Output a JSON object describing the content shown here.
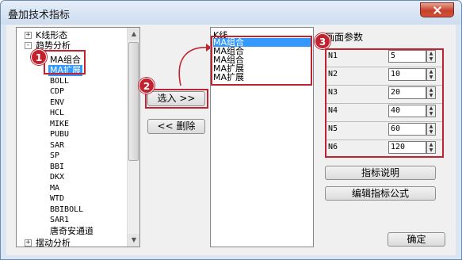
{
  "window": {
    "title": "叠加技术指标"
  },
  "tree": {
    "nodes": [
      {
        "label": "K线形态",
        "expander": "+"
      },
      {
        "label": "趋势分析",
        "expander": "-"
      },
      {
        "label": "MA组合"
      },
      {
        "label": "MA扩展"
      },
      {
        "label": "BOLL"
      },
      {
        "label": "CDP"
      },
      {
        "label": "ENV"
      },
      {
        "label": "HCL"
      },
      {
        "label": "MIKE"
      },
      {
        "label": "PUBU"
      },
      {
        "label": "SAR"
      },
      {
        "label": "SP"
      },
      {
        "label": "BBI"
      },
      {
        "label": "DKX"
      },
      {
        "label": "MA"
      },
      {
        "label": "WTD"
      },
      {
        "label": "BBIBOLL"
      },
      {
        "label": "SAR1"
      },
      {
        "label": "唐奇安通道"
      },
      {
        "label": "摆动分析",
        "expander": "+"
      }
    ]
  },
  "buttons": {
    "select_in": "选入 >>",
    "delete": "<< 删除",
    "indicator_desc": "指标说明",
    "edit_formula": "编辑指标公式",
    "ok": "确定"
  },
  "selected_list": {
    "header": "K线",
    "items": [
      "MA组合",
      "MA组合",
      "MA组合",
      "MA扩展",
      "MA扩展"
    ]
  },
  "params": {
    "title": "画面参数",
    "rows": [
      {
        "label": "N1",
        "value": "5"
      },
      {
        "label": "N2",
        "value": "10"
      },
      {
        "label": "N3",
        "value": "20"
      },
      {
        "label": "N4",
        "value": "40"
      },
      {
        "label": "N5",
        "value": "60"
      },
      {
        "label": "N6",
        "value": "120"
      }
    ]
  },
  "badges": [
    "1",
    "2",
    "3"
  ],
  "colors": {
    "highlight": "#c0232f",
    "selection": "#3399ff"
  }
}
